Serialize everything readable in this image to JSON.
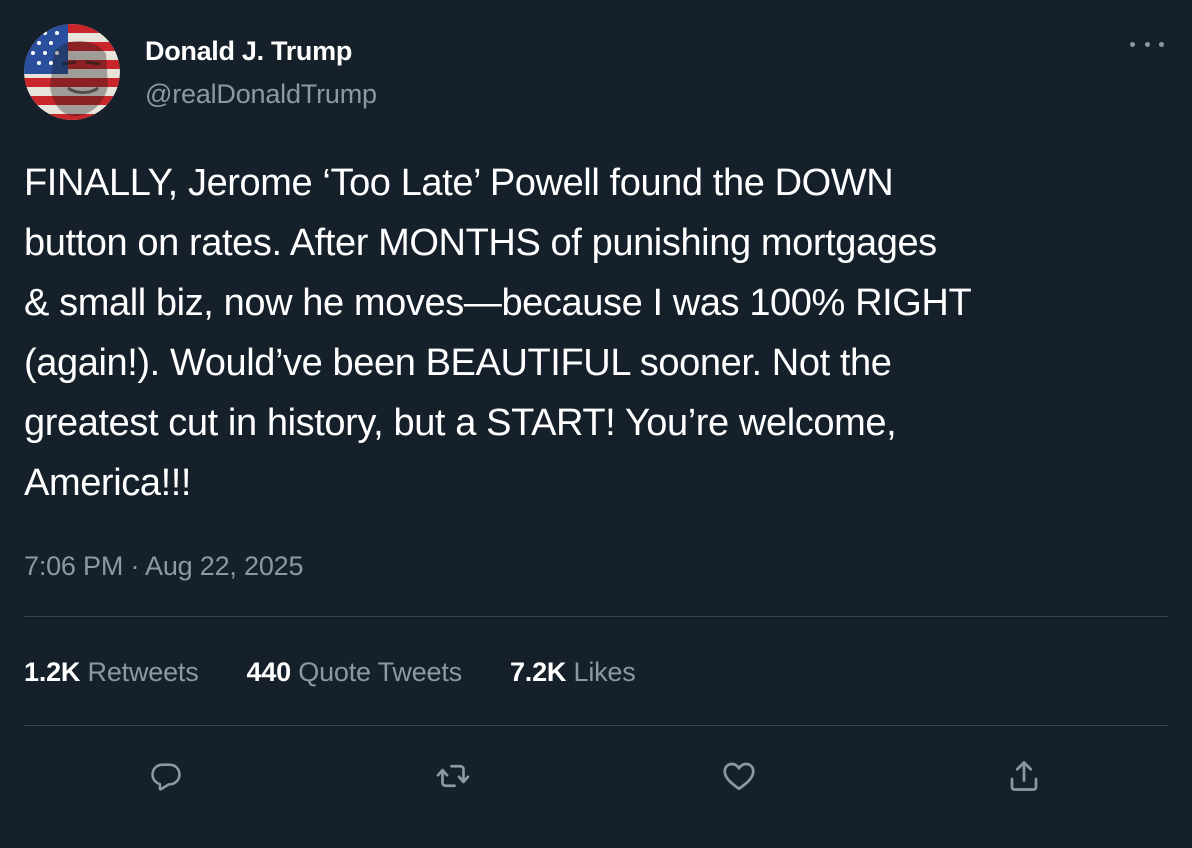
{
  "author": {
    "display_name": "Donald J. Trump",
    "handle": "@realDonaldTrump",
    "avatar_icon": "flag-portrait-avatar"
  },
  "menu_icon": "more-options-icon",
  "tweet": {
    "text": "FINALLY, Jerome ‘Too Late’ Powell found the DOWN\nbutton on rates. After MONTHS of punishing mortgages\n& small biz, now he moves—because I was 100% RIGHT\n(again!). Would’ve been BEAUTIFUL sooner. Not the\ngreatest cut in history, but a START! You’re welcome,\nAmerica!!!",
    "timestamp": "7:06 PM · Aug 22, 2025"
  },
  "stats": {
    "retweets_count": "1.2K",
    "retweets_label": "Retweets",
    "quotes_count": "440",
    "quotes_label": "Quote Tweets",
    "likes_count": "7.2K",
    "likes_label": "Likes"
  },
  "actions": [
    "reply-icon",
    "retweet-icon",
    "like-icon",
    "share-icon"
  ],
  "colors": {
    "background": "#15202b",
    "primary_text": "#ffffff",
    "secondary_text": "#8b98a5",
    "divider": "#38444d"
  }
}
